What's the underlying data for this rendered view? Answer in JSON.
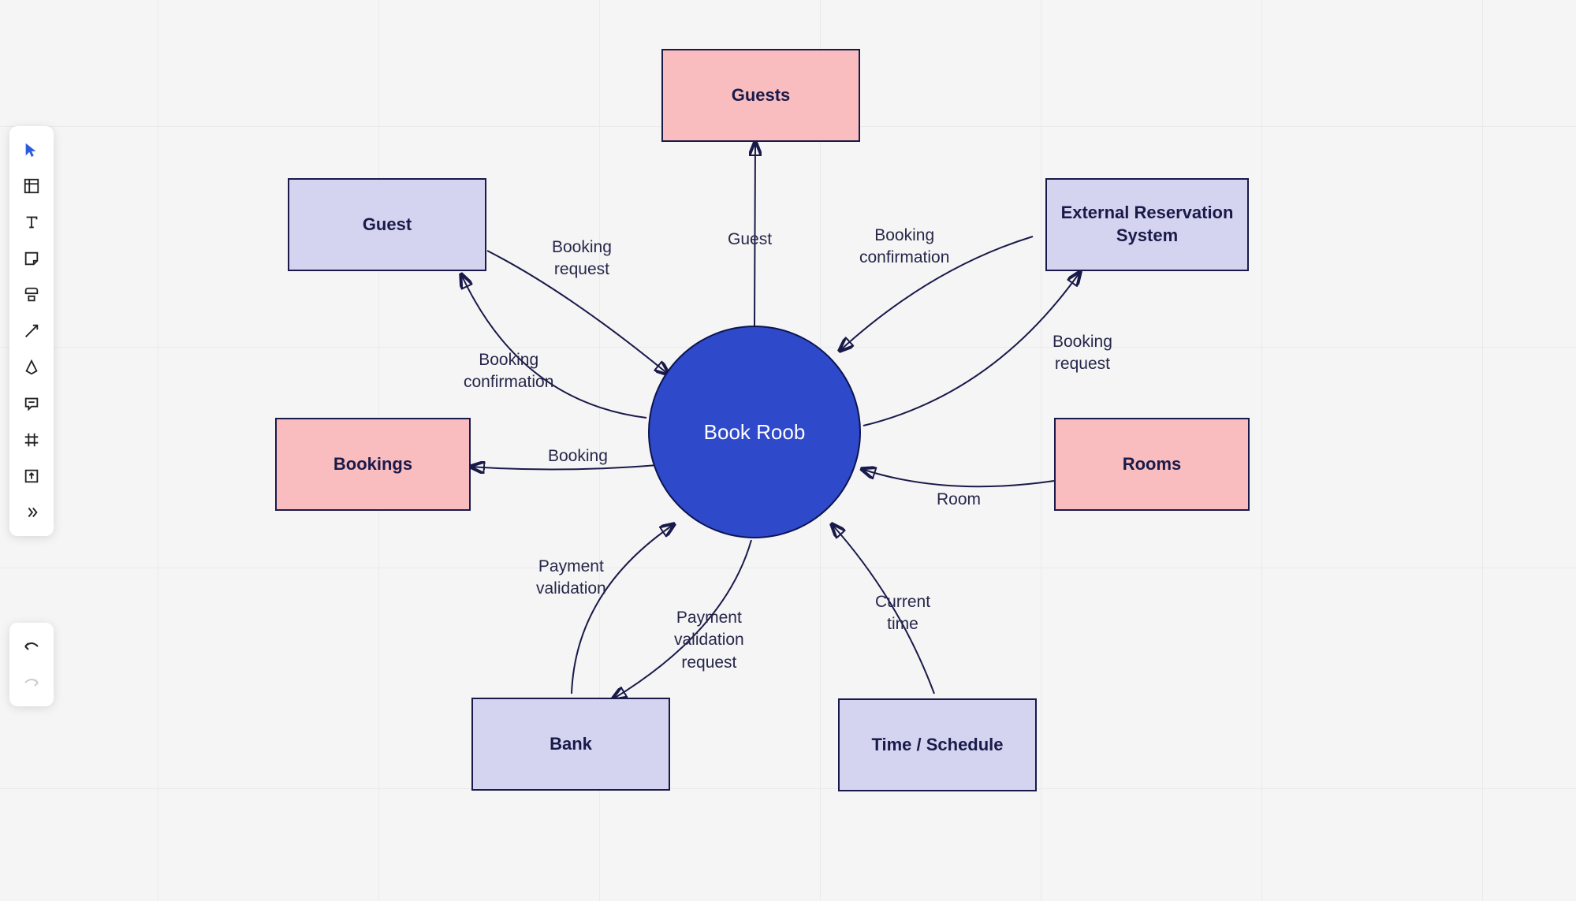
{
  "toolbar": {
    "tools": [
      {
        "name": "select",
        "active": true
      },
      {
        "name": "frame"
      },
      {
        "name": "text"
      },
      {
        "name": "sticky"
      },
      {
        "name": "shape"
      },
      {
        "name": "arrow"
      },
      {
        "name": "pen"
      },
      {
        "name": "comment"
      },
      {
        "name": "grid"
      },
      {
        "name": "upload"
      },
      {
        "name": "more"
      }
    ]
  },
  "diagram": {
    "center": {
      "label": "Book Roob"
    },
    "nodes": {
      "guests": {
        "label": "Guests",
        "color": "pink"
      },
      "guest": {
        "label": "Guest",
        "color": "lavender"
      },
      "external": {
        "label": "External Reservation System",
        "color": "lavender"
      },
      "bookings": {
        "label": "Bookings",
        "color": "pink"
      },
      "rooms": {
        "label": "Rooms",
        "color": "pink"
      },
      "bank": {
        "label": "Bank",
        "color": "lavender"
      },
      "time": {
        "label": "Time / Schedule",
        "color": "lavender"
      }
    },
    "edges": {
      "guest_to_center": {
        "label": "Booking\nrequest"
      },
      "center_to_guest": {
        "label": "Booking\nconfirmation"
      },
      "center_to_guests": {
        "label": "Guest"
      },
      "external_to_center": {
        "label": "Booking\nconfirmation"
      },
      "center_to_external": {
        "label": "Booking\nrequest"
      },
      "rooms_to_center": {
        "label": "Room"
      },
      "time_to_center": {
        "label": "Current\ntime"
      },
      "center_to_bank": {
        "label": "Payment\nvalidation\nrequest"
      },
      "bank_to_center": {
        "label": "Payment\nvalidation"
      },
      "center_to_bookings": {
        "label": "Booking"
      }
    }
  }
}
